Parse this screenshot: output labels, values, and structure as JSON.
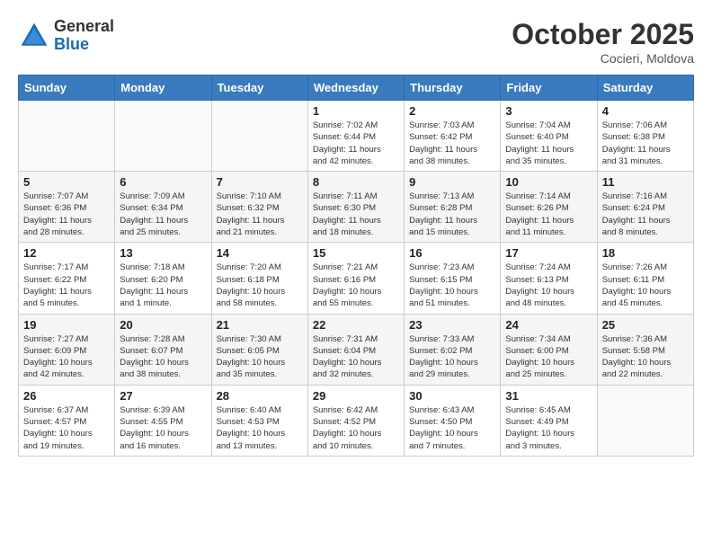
{
  "logo": {
    "general": "General",
    "blue": "Blue"
  },
  "title": "October 2025",
  "location": "Cocieri, Moldova",
  "weekdays": [
    "Sunday",
    "Monday",
    "Tuesday",
    "Wednesday",
    "Thursday",
    "Friday",
    "Saturday"
  ],
  "weeks": [
    [
      {
        "day": "",
        "info": ""
      },
      {
        "day": "",
        "info": ""
      },
      {
        "day": "",
        "info": ""
      },
      {
        "day": "1",
        "info": "Sunrise: 7:02 AM\nSunset: 6:44 PM\nDaylight: 11 hours\nand 42 minutes."
      },
      {
        "day": "2",
        "info": "Sunrise: 7:03 AM\nSunset: 6:42 PM\nDaylight: 11 hours\nand 38 minutes."
      },
      {
        "day": "3",
        "info": "Sunrise: 7:04 AM\nSunset: 6:40 PM\nDaylight: 11 hours\nand 35 minutes."
      },
      {
        "day": "4",
        "info": "Sunrise: 7:06 AM\nSunset: 6:38 PM\nDaylight: 11 hours\nand 31 minutes."
      }
    ],
    [
      {
        "day": "5",
        "info": "Sunrise: 7:07 AM\nSunset: 6:36 PM\nDaylight: 11 hours\nand 28 minutes."
      },
      {
        "day": "6",
        "info": "Sunrise: 7:09 AM\nSunset: 6:34 PM\nDaylight: 11 hours\nand 25 minutes."
      },
      {
        "day": "7",
        "info": "Sunrise: 7:10 AM\nSunset: 6:32 PM\nDaylight: 11 hours\nand 21 minutes."
      },
      {
        "day": "8",
        "info": "Sunrise: 7:11 AM\nSunset: 6:30 PM\nDaylight: 11 hours\nand 18 minutes."
      },
      {
        "day": "9",
        "info": "Sunrise: 7:13 AM\nSunset: 6:28 PM\nDaylight: 11 hours\nand 15 minutes."
      },
      {
        "day": "10",
        "info": "Sunrise: 7:14 AM\nSunset: 6:26 PM\nDaylight: 11 hours\nand 11 minutes."
      },
      {
        "day": "11",
        "info": "Sunrise: 7:16 AM\nSunset: 6:24 PM\nDaylight: 11 hours\nand 8 minutes."
      }
    ],
    [
      {
        "day": "12",
        "info": "Sunrise: 7:17 AM\nSunset: 6:22 PM\nDaylight: 11 hours\nand 5 minutes."
      },
      {
        "day": "13",
        "info": "Sunrise: 7:18 AM\nSunset: 6:20 PM\nDaylight: 11 hours\nand 1 minute."
      },
      {
        "day": "14",
        "info": "Sunrise: 7:20 AM\nSunset: 6:18 PM\nDaylight: 10 hours\nand 58 minutes."
      },
      {
        "day": "15",
        "info": "Sunrise: 7:21 AM\nSunset: 6:16 PM\nDaylight: 10 hours\nand 55 minutes."
      },
      {
        "day": "16",
        "info": "Sunrise: 7:23 AM\nSunset: 6:15 PM\nDaylight: 10 hours\nand 51 minutes."
      },
      {
        "day": "17",
        "info": "Sunrise: 7:24 AM\nSunset: 6:13 PM\nDaylight: 10 hours\nand 48 minutes."
      },
      {
        "day": "18",
        "info": "Sunrise: 7:26 AM\nSunset: 6:11 PM\nDaylight: 10 hours\nand 45 minutes."
      }
    ],
    [
      {
        "day": "19",
        "info": "Sunrise: 7:27 AM\nSunset: 6:09 PM\nDaylight: 10 hours\nand 42 minutes."
      },
      {
        "day": "20",
        "info": "Sunrise: 7:28 AM\nSunset: 6:07 PM\nDaylight: 10 hours\nand 38 minutes."
      },
      {
        "day": "21",
        "info": "Sunrise: 7:30 AM\nSunset: 6:05 PM\nDaylight: 10 hours\nand 35 minutes."
      },
      {
        "day": "22",
        "info": "Sunrise: 7:31 AM\nSunset: 6:04 PM\nDaylight: 10 hours\nand 32 minutes."
      },
      {
        "day": "23",
        "info": "Sunrise: 7:33 AM\nSunset: 6:02 PM\nDaylight: 10 hours\nand 29 minutes."
      },
      {
        "day": "24",
        "info": "Sunrise: 7:34 AM\nSunset: 6:00 PM\nDaylight: 10 hours\nand 25 minutes."
      },
      {
        "day": "25",
        "info": "Sunrise: 7:36 AM\nSunset: 5:58 PM\nDaylight: 10 hours\nand 22 minutes."
      }
    ],
    [
      {
        "day": "26",
        "info": "Sunrise: 6:37 AM\nSunset: 4:57 PM\nDaylight: 10 hours\nand 19 minutes."
      },
      {
        "day": "27",
        "info": "Sunrise: 6:39 AM\nSunset: 4:55 PM\nDaylight: 10 hours\nand 16 minutes."
      },
      {
        "day": "28",
        "info": "Sunrise: 6:40 AM\nSunset: 4:53 PM\nDaylight: 10 hours\nand 13 minutes."
      },
      {
        "day": "29",
        "info": "Sunrise: 6:42 AM\nSunset: 4:52 PM\nDaylight: 10 hours\nand 10 minutes."
      },
      {
        "day": "30",
        "info": "Sunrise: 6:43 AM\nSunset: 4:50 PM\nDaylight: 10 hours\nand 7 minutes."
      },
      {
        "day": "31",
        "info": "Sunrise: 6:45 AM\nSunset: 4:49 PM\nDaylight: 10 hours\nand 3 minutes."
      },
      {
        "day": "",
        "info": ""
      }
    ]
  ]
}
